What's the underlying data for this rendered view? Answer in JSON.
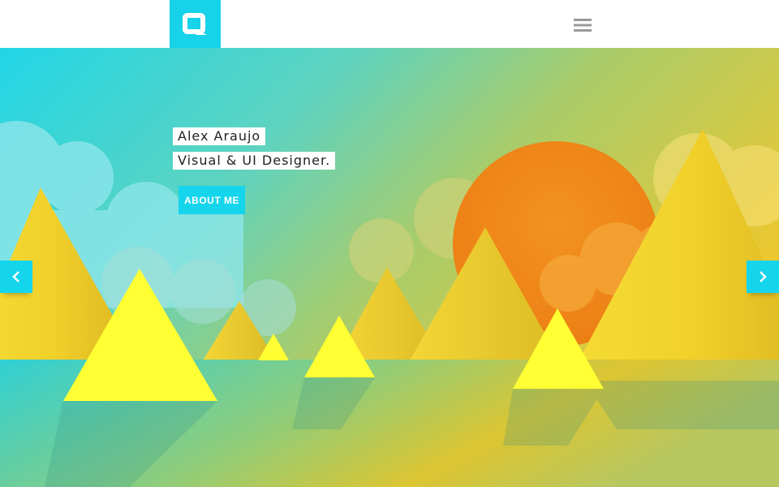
{
  "header": {
    "logo_icon": "brand-logo-icon",
    "menu_icon": "hamburger-menu-icon"
  },
  "hero": {
    "name": "Alex Araujo",
    "role": "Visual & UI Designer.",
    "cta_label": "ABOUT ME",
    "prev_icon": "chevron-left-icon",
    "next_icon": "chevron-right-icon"
  },
  "colors": {
    "accent": "#17d3e9",
    "sun": "#f08a1c",
    "mountain": "#f4d12a",
    "ground_left": "#3fd1cf",
    "ground_right": "#e7c22a"
  }
}
